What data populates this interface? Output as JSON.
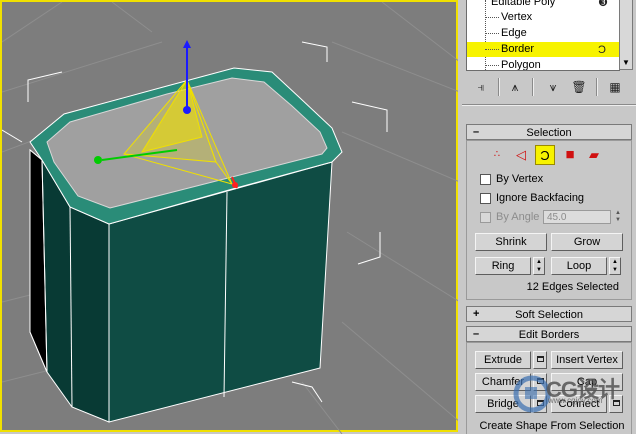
{
  "modifier_stack": {
    "items": [
      {
        "label": "Editable Poly",
        "selected": false
      },
      {
        "label": "Vertex",
        "selected": false
      },
      {
        "label": "Edge",
        "selected": false
      },
      {
        "label": "Border",
        "selected": true
      },
      {
        "label": "Polygon",
        "selected": false
      }
    ],
    "toolbar_icons": [
      "pin-stack-icon",
      "show-end-result-icon",
      "make-unique-icon",
      "remove-modifier-icon",
      "configure-modifier-sets-icon"
    ]
  },
  "selection": {
    "title": "Selection",
    "by_vertex": "By Vertex",
    "ignore_backfacing": "Ignore Backfacing",
    "by_angle": "By Angle",
    "angle_value": "45.0",
    "shrink": "Shrink",
    "grow": "Grow",
    "ring": "Ring",
    "loop": "Loop",
    "status": "12 Edges Selected",
    "active_subobject": "border"
  },
  "soft_selection": {
    "title": "Soft Selection"
  },
  "edit_borders": {
    "title": "Edit Borders",
    "extrude": "Extrude",
    "insert_vertex": "Insert Vertex",
    "chamfer": "Chamfer",
    "cap": "Cap",
    "bridge": "Bridge",
    "connect": "Connect",
    "create_shape": "Create Shape From Selection"
  },
  "watermark": {
    "text": "CG设计",
    "url": "www.cgjoy.com"
  },
  "colors": {
    "viewport_border": "#f0e000",
    "selection_highlight": "#f7f300",
    "model_side": "#0f4c44",
    "model_rim": "#2a8c78"
  }
}
